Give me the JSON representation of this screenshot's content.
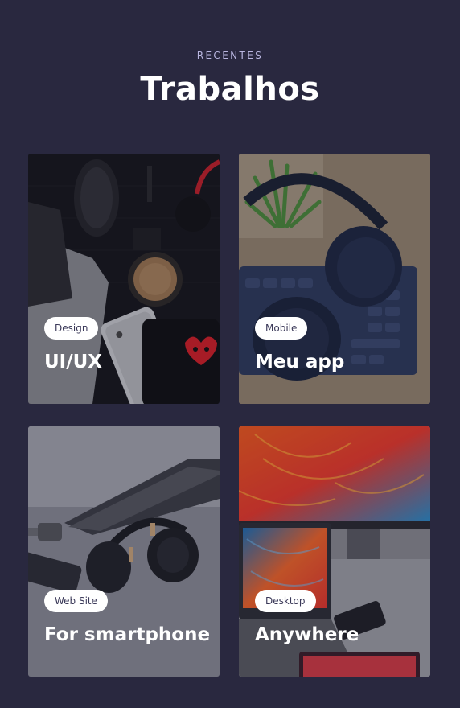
{
  "section": {
    "eyebrow": "RECENTES",
    "title": "Trabalhos"
  },
  "cards": [
    {
      "tag": "Design",
      "title": "UI/UX",
      "image": "desk-iphone-mouse-coffee-photo"
    },
    {
      "tag": "Mobile",
      "title": "Meu app",
      "image": "headphones-keyboard-plant-photo"
    },
    {
      "tag": "Web Site",
      "title": "For smartphone",
      "image": "headphones-laptop-desk-photo"
    },
    {
      "tag": "Desktop",
      "title": "Anywhere",
      "image": "colorful-monitor-laptop-photo"
    }
  ],
  "colors": {
    "background": "#29283f",
    "eyebrow": "#b9b6e0",
    "tag_bg": "#ffffff",
    "tag_text": "#3a3858"
  }
}
